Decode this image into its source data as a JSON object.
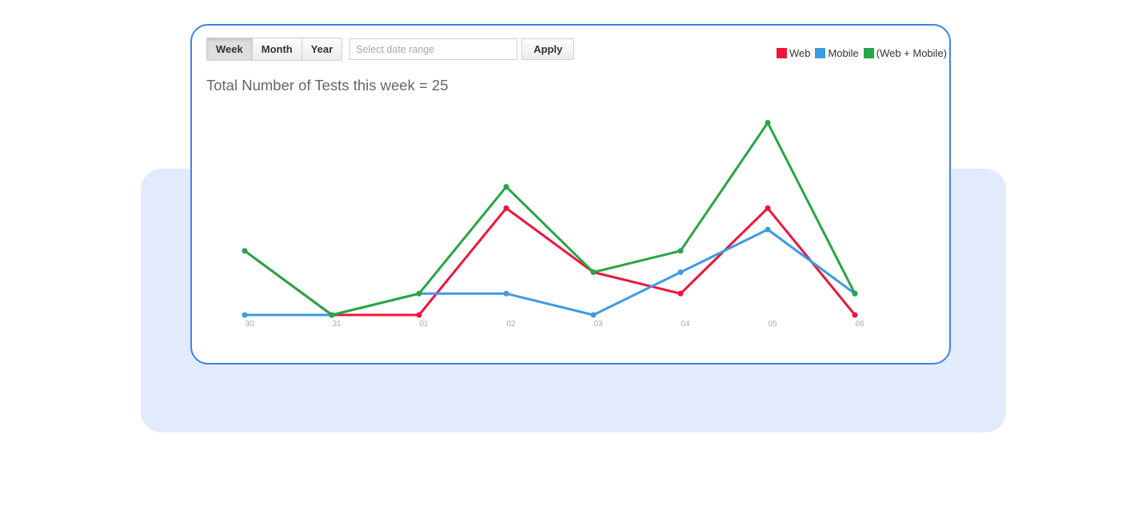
{
  "toolbar": {
    "periods": [
      "Week",
      "Month",
      "Year"
    ],
    "active_period": "Week",
    "date_placeholder": "Select date range",
    "apply_label": "Apply"
  },
  "chart_data": {
    "type": "line",
    "title": "Total Number of Tests this week = 25",
    "xlabel": "",
    "ylabel": "",
    "categories": [
      "30",
      "31",
      "01",
      "02",
      "03",
      "04",
      "05",
      "06"
    ],
    "ylim": [
      0,
      9
    ],
    "grid": false,
    "legend_position": "top-right",
    "series": [
      {
        "name": "Web",
        "color": "#f0143c",
        "values": [
          3,
          0,
          0,
          5,
          2,
          1,
          5,
          0
        ]
      },
      {
        "name": "Mobile",
        "color": "#3c9be1",
        "values": [
          0,
          0,
          1,
          1,
          0,
          2,
          4,
          1
        ]
      },
      {
        "name": "(Web + Mobile)",
        "color": "#28a546",
        "values": [
          3,
          0,
          1,
          6,
          2,
          3,
          9,
          1
        ]
      }
    ]
  }
}
